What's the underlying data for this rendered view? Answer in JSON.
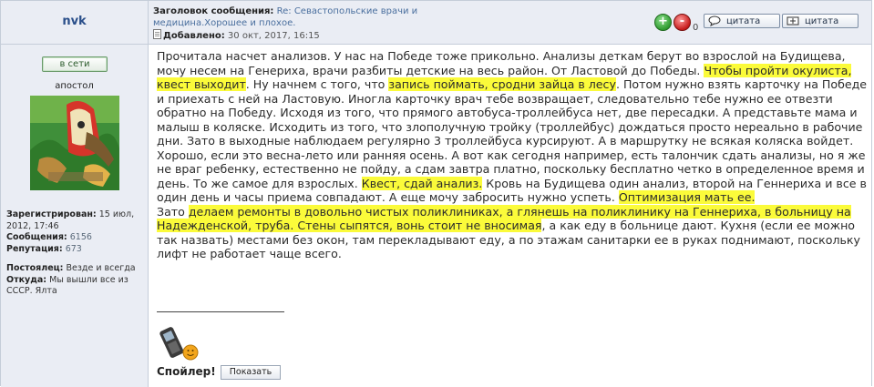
{
  "user": {
    "name": "nvk",
    "online_label": "в сети",
    "rank": "апостол",
    "registered_label": "Зарегистрирован:",
    "registered_value": "15 июл, 2012, 17:46",
    "posts_label": "Сообщения:",
    "posts_value": "6156",
    "reputation_label": "Репутация:",
    "reputation_value": "673",
    "status_label": "Постоялец:",
    "status_value": "Везде и всегда",
    "from_label": "Откуда:",
    "from_value": "Мы вышли все из СССР. Ялта"
  },
  "post": {
    "subject_label": "Заголовок сообщения:",
    "subject_value": "Re: Севастопольские врачи и медицина.Хорошее и плохое.",
    "date_label": "Добавлено:",
    "date_value": "30 окт, 2017, 16:15",
    "rating_count": "0",
    "quote_label_1": "цитата",
    "quote_label_2": "цитата",
    "rate_plus": "+",
    "rate_minus": "-",
    "paragraph1": [
      {
        "t": "Прочитала насчет анализов. У нас на Победе тоже прикольно. Анализы деткам берут во взрослой на Будищева, мочу несем на Генериха, врачи разбиты детские на весь район. От Ластовой до Победы. ",
        "h": false
      },
      {
        "t": "Чтобы пройти окулиста, квест выходит",
        "h": true
      },
      {
        "t": ". Ну начнем с того, что ",
        "h": false
      },
      {
        "t": "запись поймать, сродни зайца в лесу",
        "h": true
      },
      {
        "t": ". Потом нужно взять карточку на Победе и приехать с ней на Ластовую. Иногла карточку врач тебе возвращает, следовательно тебе нужно ее отвезти обратно на Победу. Исходя из того, что прямого автобуса-троллейбуса нет, две пересадки. А представьте мама и малыш в коляске. Исходить из того, что злополучную тройку (троллейбус) дождаться просто нереально в рабочие дни. Зато в выходные наблюдаем регулярно 3 троллейбуса курсируют. А в маршрутку не всякая коляска войдет. Хорошо, если это весна-лето или ранняя осень. А вот как сегодня например, есть талончик сдать анализы, но я же не враг ребенку, естественно не пойду, а сдам завтра платно, поскольку бесплатно четко в определенное время и день. То же самое для взрослых. ",
        "h": false
      },
      {
        "t": "Квест, сдай анализ.",
        "h": true
      },
      {
        "t": " Кровь на Будищева один анализ, второй на Геннериха и все в один день и часы приема совпадают. А еще мочу забросить нужно успеть. ",
        "h": false
      },
      {
        "t": "Оптимизация мать ее.",
        "h": true
      }
    ],
    "paragraph2": [
      {
        "t": "Зато ",
        "h": false
      },
      {
        "t": "делаем ремонты в довольно чистых поликлиниках, а глянешь на поликлинику на Геннериха, в больницу на Надежденской, труба. Стены сыпятся, вонь стоит не вносимая",
        "h": true
      },
      {
        "t": ", а как еду в больнице дают. Кухня (если ее можно так назвать) местами без окон, там перекладывают еду, а по этажам санитарки ее в руках поднимают, поскольку лифт не работает чаще всего.",
        "h": false
      }
    ],
    "spoiler_label": "Спойлер!",
    "show_label": "Показать"
  },
  "colors": {
    "panel_bg": "#eaedf4",
    "border": "#c5cdd9",
    "highlight": "#fbfb3a",
    "link": "#4a6f9e",
    "username": "#2a4f8a"
  }
}
